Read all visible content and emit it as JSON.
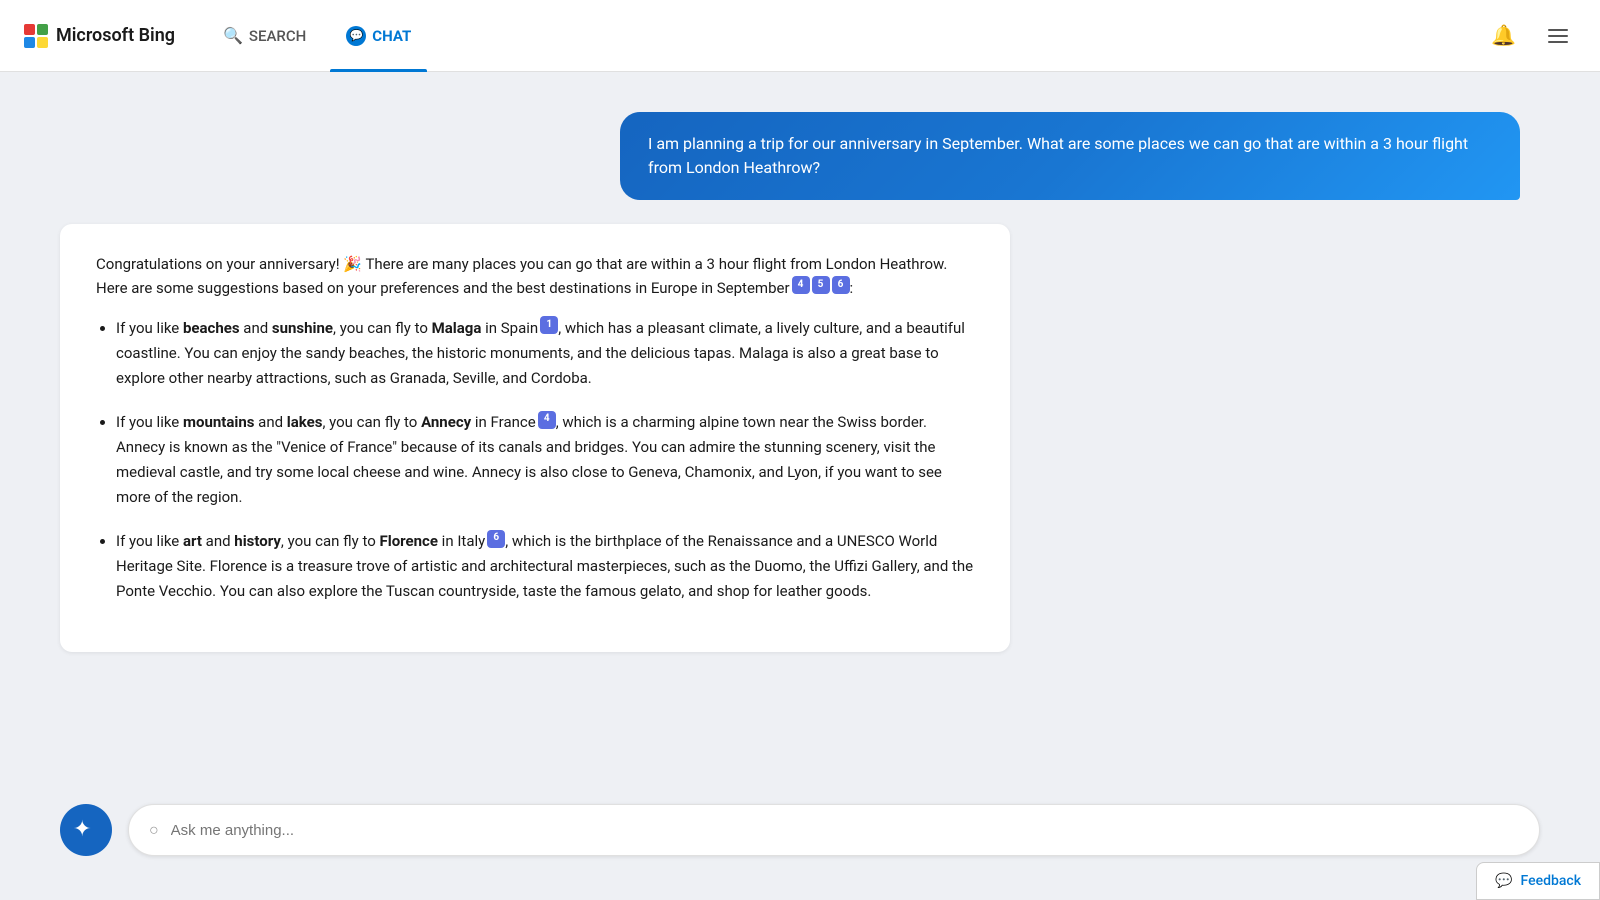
{
  "header": {
    "logo_text": "Microsoft Bing",
    "nav": [
      {
        "id": "search",
        "label": "SEARCH",
        "active": false
      },
      {
        "id": "chat",
        "label": "CHAT",
        "active": true
      }
    ]
  },
  "chat": {
    "user_message": "I am planning a trip for our anniversary in September. What are some places we can go that are within a 3 hour flight from London Heathrow?",
    "ai_response": {
      "intro": "Congratulations on your anniversary! 🎉 There are many places you can go that are within a 3 hour flight from London Heathrow. Here are some suggestions based on your preferences and the best destinations in Europe in September",
      "intro_citations": [
        "4",
        "5",
        "6"
      ],
      "items": [
        {
          "text_before": "If you like ",
          "bold1": "beaches",
          "and": " and ",
          "bold2": "sunshine",
          "text_mid": ", you can fly to ",
          "destination": "Malaga",
          "text_loc": " in Spain",
          "citation": "1",
          "text_after": ", which has a pleasant climate, a lively culture, and a beautiful coastline. You can enjoy the sandy beaches, the historic monuments, and the delicious tapas. Malaga is also a great base to explore other nearby attractions, such as Granada, Seville, and Cordoba."
        },
        {
          "text_before": "If you like ",
          "bold1": "mountains",
          "and": " and ",
          "bold2": "lakes",
          "text_mid": ", you can fly to ",
          "destination": "Annecy",
          "text_loc": " in France",
          "citation": "4",
          "text_after": ", which is a charming alpine town near the Swiss border. Annecy is known as the \"Venice of France\" because of its canals and bridges. You can admire the stunning scenery, visit the medieval castle, and try some local cheese and wine. Annecy is also close to Geneva, Chamonix, and Lyon, if you want to see more of the region."
        },
        {
          "text_before": "If you like ",
          "bold1": "art",
          "and": " and ",
          "bold2": "history",
          "text_mid": ", you can fly to ",
          "destination": "Florence",
          "text_loc": " in Italy",
          "citation": "6",
          "text_after": ", which is the birthplace of the Renaissance and a UNESCO World Heritage Site. Florence is a treasure trove of artistic and architectural masterpieces, such as the Duomo, the Uffizi Gallery, and the Ponte Vecchio. You can also explore the Tuscan countryside, taste the famous gelato, and shop for leather goods."
        }
      ]
    }
  },
  "input": {
    "placeholder": "Ask me anything..."
  },
  "feedback": {
    "label": "Feedback"
  }
}
